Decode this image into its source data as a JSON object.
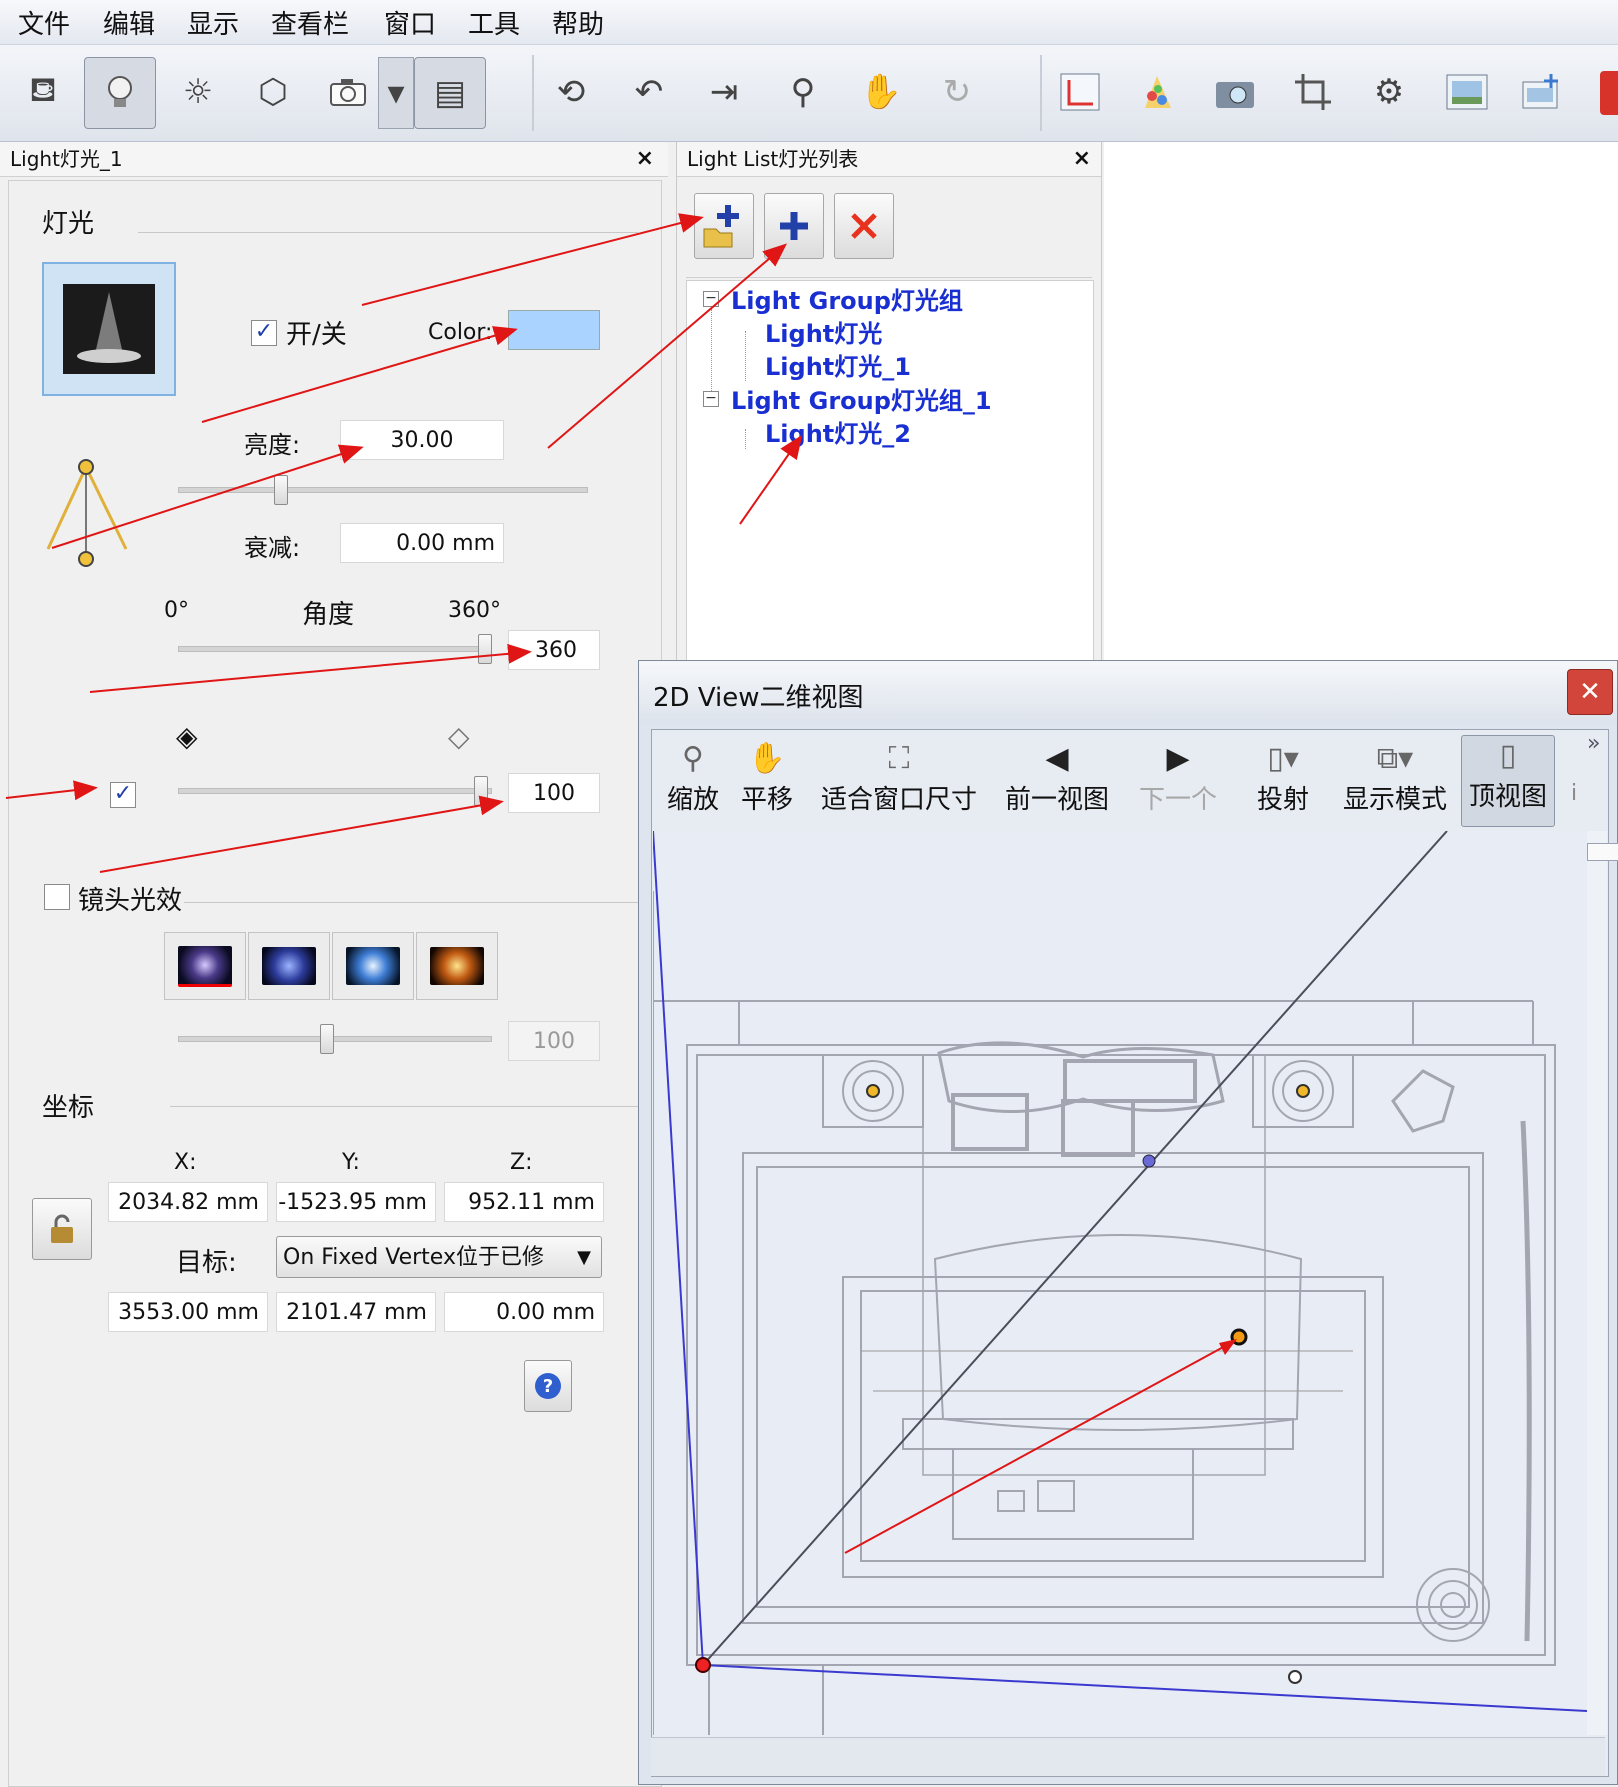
{
  "menu": [
    "文件",
    "编辑",
    "显示",
    "查看栏",
    "窗口",
    "工具",
    "帮助"
  ],
  "toolbar_icons": [
    "paint-bucket-icon",
    "light-bulb-icon",
    "sun-icon",
    "cube-icon",
    "camera-icon",
    "dropdown-icon",
    "page-icon",
    "orbit-icon",
    "undo-icon",
    "walk-icon",
    "zoom-icon",
    "pan-hand-icon",
    "redo-icon",
    "axes-icon",
    "palette-icon",
    "snapshot-icon",
    "crop-icon",
    "gear-icon",
    "image-icon",
    "export-icon"
  ],
  "light_panel": {
    "title": "Light灯光_1",
    "close": "×",
    "section_light": "灯光",
    "on_off_label": "开/关",
    "on_off_checked": true,
    "color_label": "Color:",
    "color_value": "#aad4ff",
    "brightness_label": "亮度:",
    "brightness_value": "30.00",
    "decay_label": "衰减:",
    "decay_value": "0.00 mm",
    "angle_min": "0°",
    "angle_label": "角度",
    "angle_max": "360°",
    "angle_value": "360",
    "shadow_checked": true,
    "shadow_value": "100",
    "flare_label": "镜头光效",
    "flare_checked": false,
    "flare_value": "100",
    "coords_label": "坐标",
    "x_label": "X:",
    "y_label": "Y:",
    "z_label": "Z:",
    "x_value": "2034.82 mm",
    "y_value": "-1523.95 mm",
    "z_value": "952.11 mm",
    "target_label": "目标:",
    "target_select": "On Fixed Vertex位于已修",
    "tx_value": "3553.00 mm",
    "ty_value": "2101.47 mm",
    "tz_value": "0.00 mm"
  },
  "light_list": {
    "title": "Light List灯光列表",
    "close": "×",
    "tree": [
      {
        "label": "Light Group灯光组",
        "level": 0,
        "expander": "−"
      },
      {
        "label": "Light灯光",
        "level": 1
      },
      {
        "label": "Light灯光_1",
        "level": 1
      },
      {
        "label": "Light Group灯光组_1",
        "level": 0,
        "expander": "−"
      },
      {
        "label": "Light灯光_2",
        "level": 1
      }
    ]
  },
  "view2d": {
    "title": "2D View二维视图",
    "close": "✕",
    "more": "»",
    "tools": [
      {
        "label": "缩放",
        "icon": "magnifier-icon"
      },
      {
        "label": "平移",
        "icon": "hand-icon"
      },
      {
        "label": "适合窗口尺寸",
        "icon": "fit-window-icon"
      },
      {
        "label": "前一视图",
        "icon": "arrow-left-icon"
      },
      {
        "label": "下一个",
        "icon": "arrow-right-icon"
      },
      {
        "label": "投射",
        "icon": "projection-icon"
      },
      {
        "label": "显示模式",
        "icon": "display-mode-icon"
      },
      {
        "label": "顶视图",
        "icon": "top-view-icon"
      }
    ],
    "trailing": "i"
  }
}
